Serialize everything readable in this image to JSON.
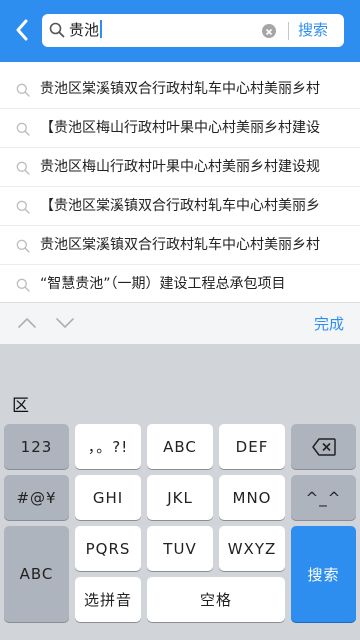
{
  "header": {
    "query": "贵池",
    "search_label": "搜索"
  },
  "suggestions": [
    "贵池区棠溪镇双合行政村轧车中心村美丽乡村",
    "【贵池区梅山行政村叶果中心村美丽乡村建设",
    "贵池区梅山行政村叶果中心村美丽乡村建设规",
    "【贵池区棠溪镇双合行政村轧车中心村美丽乡",
    "贵池区棠溪镇双合行政村轧车中心村美丽乡村",
    "“智慧贵池”（一期）建设工程总承包项目"
  ],
  "accessory": {
    "done_label": "完成"
  },
  "keyboard": {
    "candidate": "区",
    "keys": {
      "num": "123",
      "punct": "，。?!",
      "abc": "ABC",
      "def": "DEF",
      "symbols": "#@¥",
      "ghi": "GHI",
      "jkl": "JKL",
      "mno": "MNO",
      "emoticon": "^_^",
      "abc_mode": "ABC",
      "pqrs": "PQRS",
      "tuv": "TUV",
      "wxyz": "WXYZ",
      "pinyin": "选拼音",
      "space": "空格",
      "search": "搜索"
    }
  },
  "colors": {
    "accent": "#2d8ef0",
    "keyboard_bg": "#d1d4d9",
    "dark_key": "#aeb4bd"
  }
}
